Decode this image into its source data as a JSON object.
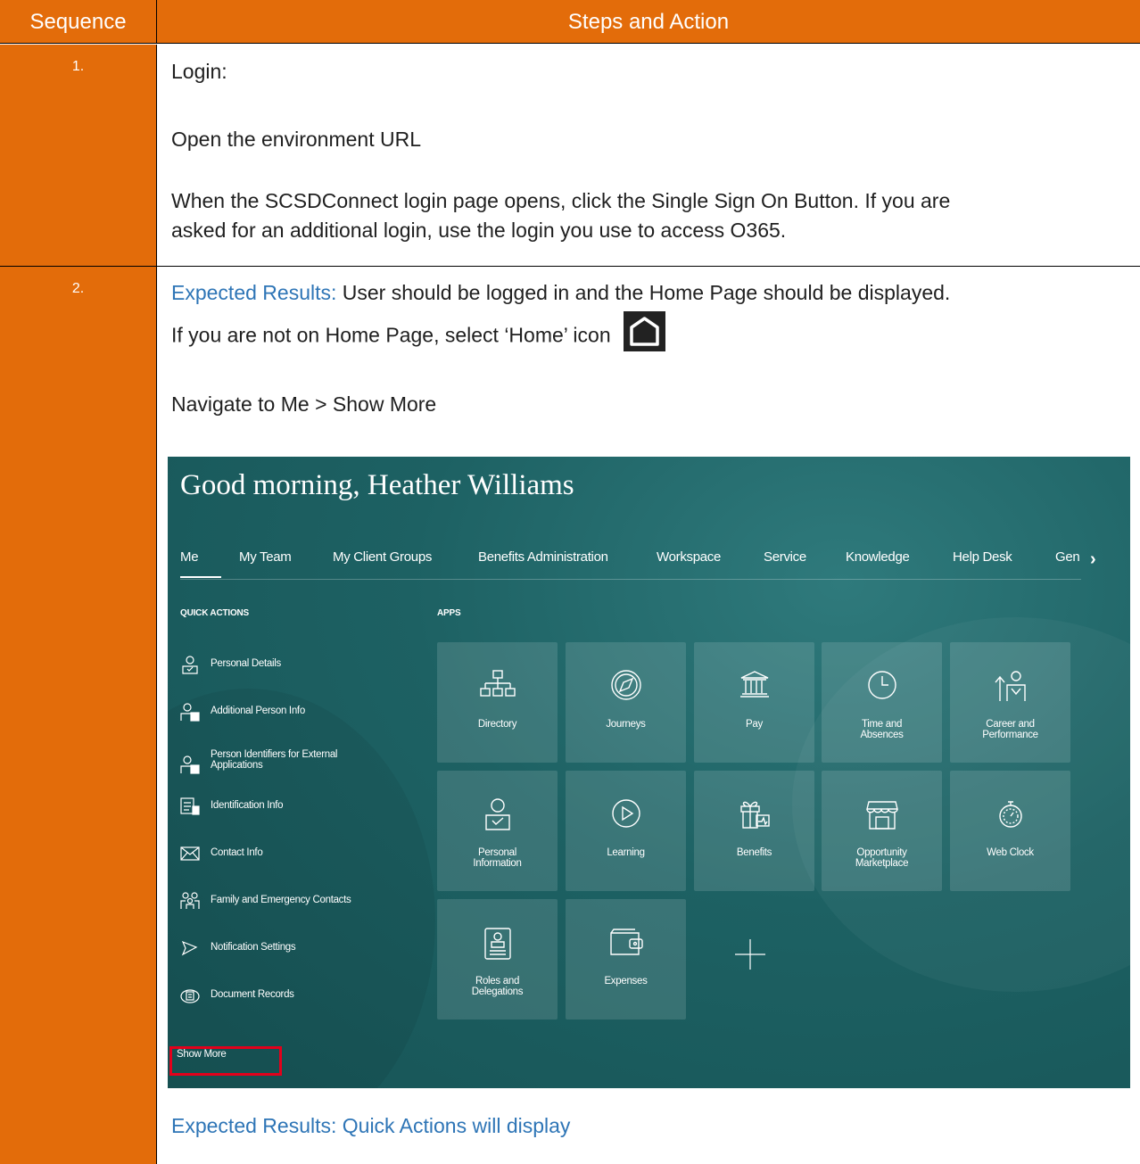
{
  "table": {
    "header": {
      "sequence": "Sequence",
      "steps": "Steps and Action"
    },
    "row1": {
      "seq": "1.",
      "title": "Login:",
      "line1": "Open the environment URL",
      "line2a": "When the SCSDConnect login page opens, click the Single Sign On Button. If you are",
      "line2b": "asked for an additional login, use the login you use to access O365.",
      "expected_label": "Expected Results:",
      "expected_text": " User should be logged in and the Home Page should be displayed.",
      "home_note": "If you are not on Home Page, select ‘Home’ icon",
      "home_icon": "home-icon"
    },
    "row2": {
      "seq": "2.",
      "title": "Navigate to Me > Show More",
      "expected": "Expected Results: Quick Actions will display"
    }
  },
  "screenshot": {
    "greeting": "Good morning, Heather Williams",
    "nav": [
      "Me",
      "My Team",
      "My Client Groups",
      "Benefits Administration",
      "Workspace",
      "Service",
      "Knowledge",
      "Help Desk",
      "Gen"
    ],
    "nav_more": "›",
    "quick_actions_label": "QUICK ACTIONS",
    "apps_label": "APPS",
    "quick_actions": [
      {
        "label": "Personal Details",
        "icon": "person-icon"
      },
      {
        "label": "Additional Person Info",
        "icon": "person-card-icon"
      },
      {
        "label": "Person Identifiers for External",
        "label2": "Applications",
        "icon": "person-card-icon"
      },
      {
        "label": "Identification Info",
        "icon": "id-card-icon"
      },
      {
        "label": "Contact Info",
        "icon": "envelope-icon"
      },
      {
        "label": "Family and Emergency Contacts",
        "icon": "family-icon"
      },
      {
        "label": "Notification Settings",
        "icon": "notification-icon"
      },
      {
        "label": "Document Records",
        "icon": "document-records-icon"
      }
    ],
    "show_more": "Show More",
    "apps": [
      {
        "label": "Directory",
        "icon": "org-chart-icon"
      },
      {
        "label": "Journeys",
        "icon": "compass-icon"
      },
      {
        "label": "Pay",
        "icon": "bank-icon"
      },
      {
        "label": "Time and",
        "label2": "Absences",
        "icon": "clock-icon"
      },
      {
        "label": "Career and",
        "label2": "Performance",
        "icon": "career-icon"
      },
      {
        "label": "Personal",
        "label2": "Information",
        "icon": "person-icon"
      },
      {
        "label": "Learning",
        "icon": "play-icon"
      },
      {
        "label": "Benefits",
        "icon": "gift-icon"
      },
      {
        "label": "Opportunity",
        "label2": "Marketplace",
        "icon": "store-icon"
      },
      {
        "label": "Web Clock",
        "icon": "stopwatch-icon"
      },
      {
        "label": "Roles and",
        "label2": "Delegations",
        "icon": "badge-icon"
      },
      {
        "label": "Expenses",
        "icon": "wallet-icon"
      }
    ],
    "add_tile": "plus-icon"
  }
}
